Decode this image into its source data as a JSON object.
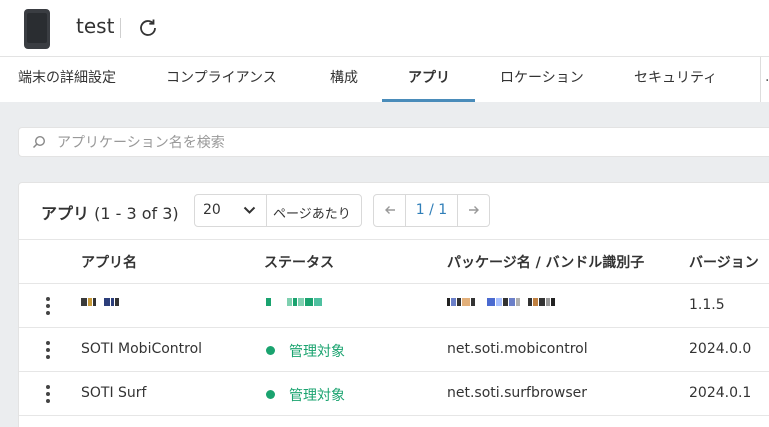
{
  "header": {
    "device_name": "test"
  },
  "tabs": [
    {
      "label": "端末の詳細設定",
      "active": false
    },
    {
      "label": "コンプライアンス",
      "active": false
    },
    {
      "label": "構成",
      "active": false
    },
    {
      "label": "アプリ",
      "active": true
    },
    {
      "label": "ロケーション",
      "active": false
    },
    {
      "label": "セキュリティ",
      "active": false
    }
  ],
  "search": {
    "placeholder": "アプリケーション名を検索"
  },
  "apps_panel": {
    "title": "アプリ",
    "count_text": "(1 - 3 of 3)",
    "page_size": "20",
    "page_size_label": "ページあたり",
    "page_indicator": "1 / 1"
  },
  "table": {
    "columns": [
      "アプリ名",
      "ステータス",
      "パッケージ名 / バンドル識別子",
      "バージョン"
    ],
    "rows": [
      {
        "name": "",
        "status": "",
        "package": "",
        "version": "1.1.5",
        "redacted": true
      },
      {
        "name": "SOTI MobiControl",
        "status": "管理対象",
        "package": "net.soti.mobicontrol",
        "version": "2024.0.0",
        "redacted": false
      },
      {
        "name": "SOTI Surf",
        "status": "管理対象",
        "package": "net.soti.surfbrowser",
        "version": "2024.0.1",
        "redacted": false
      }
    ]
  },
  "colors": {
    "accent": "#4a8cba",
    "status_managed": "#1aa36f",
    "link": "#2f7eb8"
  }
}
